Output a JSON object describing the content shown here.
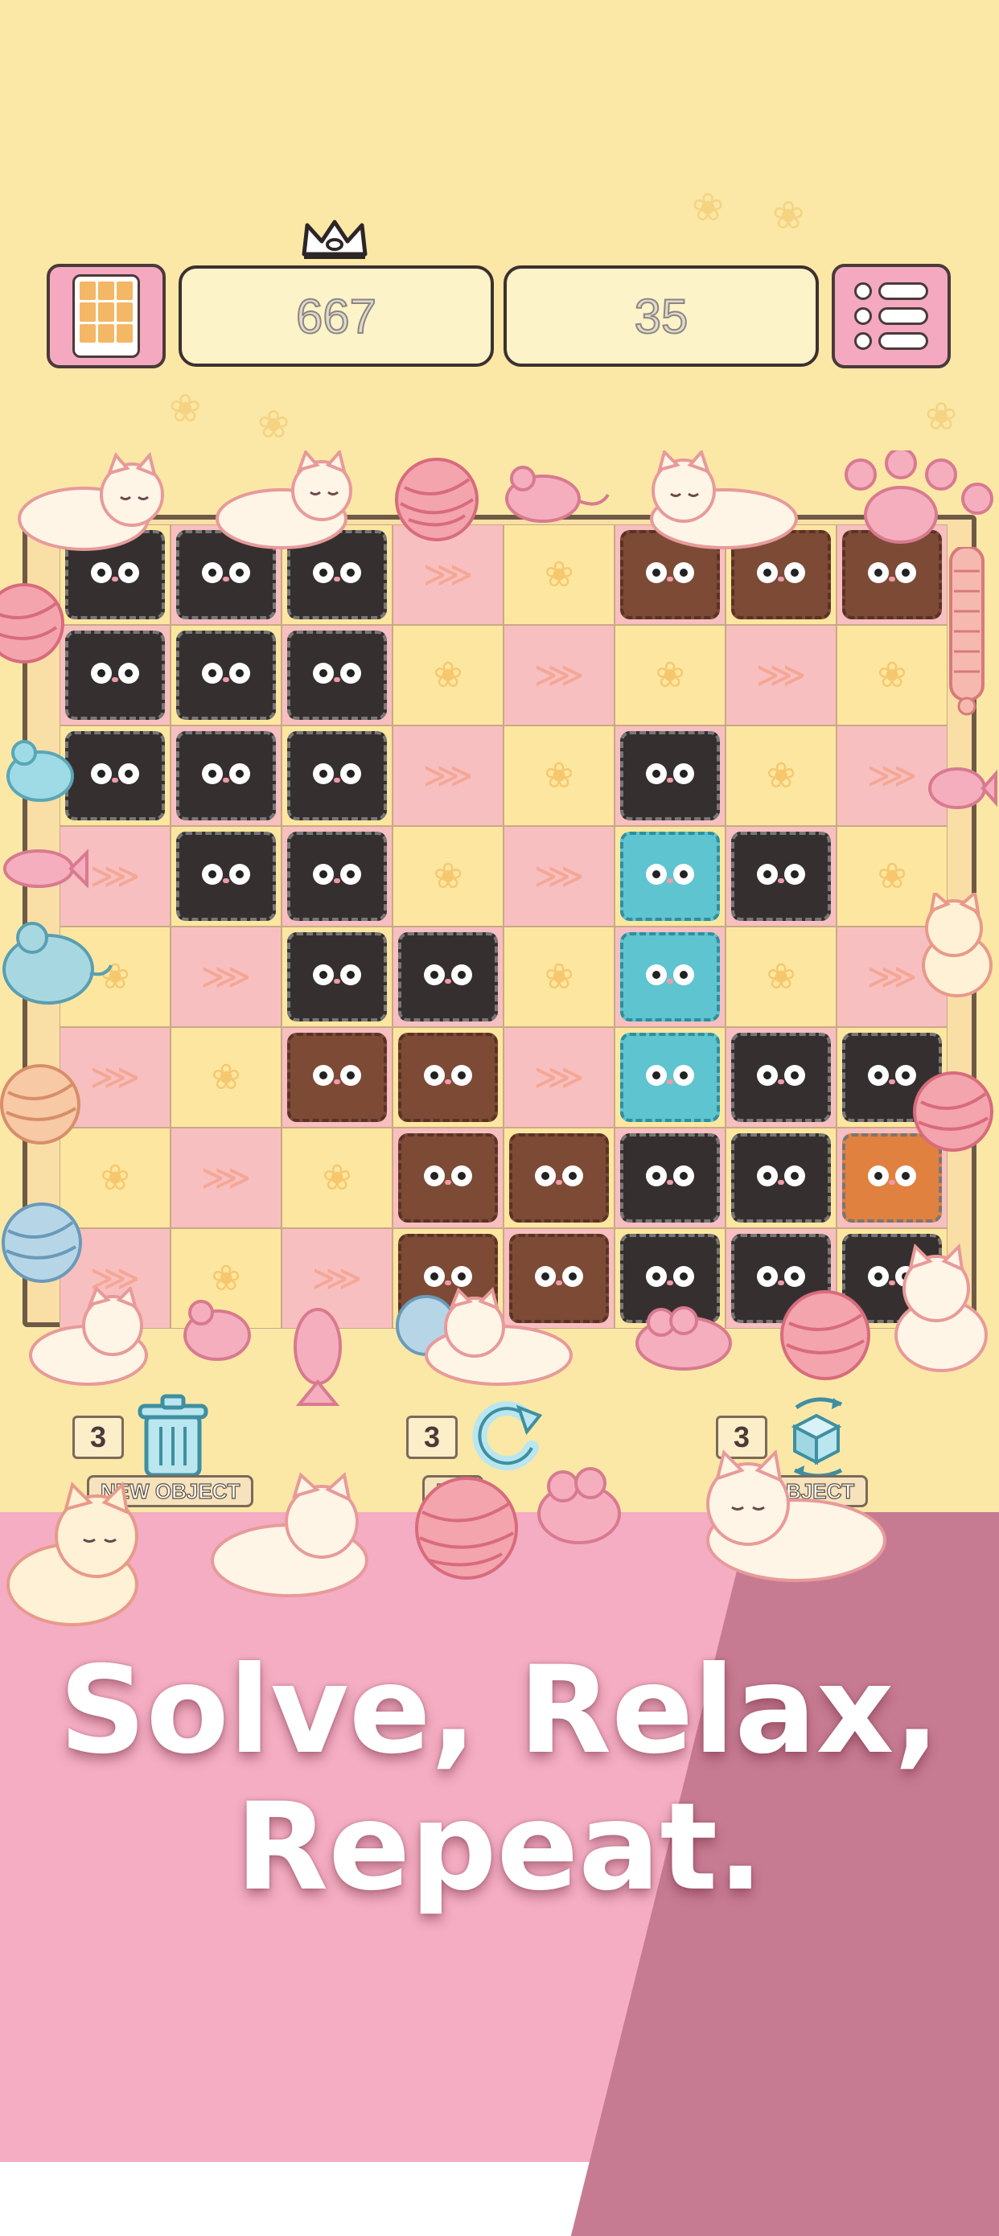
{
  "header": {
    "left_button_icon": "tablet-grid-icon",
    "best_score": "667",
    "current_score": "35",
    "crown_icon": "crown-icon",
    "right_button_icon": "menu-list-icon"
  },
  "board": {
    "rows": 8,
    "cols": 8,
    "tile_pattern": [
      [
        "yellow",
        "pink",
        "yellow",
        "pink",
        "yellow",
        "pink",
        "yellow",
        "pink"
      ],
      [
        "pink",
        "yellow",
        "pink",
        "yellow",
        "pink",
        "yellow",
        "pink",
        "yellow"
      ],
      [
        "yellow",
        "pink",
        "yellow",
        "pink",
        "yellow",
        "pink",
        "yellow",
        "pink"
      ],
      [
        "pink",
        "yellow",
        "pink",
        "yellow",
        "pink",
        "yellow",
        "pink",
        "yellow"
      ],
      [
        "yellow",
        "pink",
        "yellow",
        "pink",
        "yellow",
        "pink",
        "yellow",
        "pink"
      ],
      [
        "pink",
        "yellow",
        "pink",
        "yellow",
        "pink",
        "yellow",
        "pink",
        "yellow"
      ],
      [
        "yellow",
        "pink",
        "yellow",
        "pink",
        "yellow",
        "pink",
        "yellow",
        "pink"
      ],
      [
        "pink",
        "yellow",
        "pink",
        "yellow",
        "pink",
        "yellow",
        "pink",
        "yellow"
      ]
    ],
    "pieces": [
      [
        "black",
        "black",
        "black",
        "",
        "",
        "brown",
        "brown",
        "brown"
      ],
      [
        "black",
        "black",
        "black",
        "",
        "",
        "",
        "",
        ""
      ],
      [
        "black",
        "black",
        "black",
        "",
        "",
        "black",
        "",
        ""
      ],
      [
        "",
        "black",
        "black",
        "",
        "",
        "teal",
        "black",
        ""
      ],
      [
        "",
        "",
        "black",
        "black",
        "",
        "teal",
        "",
        ""
      ],
      [
        "",
        "",
        "brown",
        "brown",
        "",
        "teal",
        "black",
        "black"
      ],
      [
        "",
        "",
        "",
        "brown",
        "brown",
        "black",
        "black",
        "special"
      ],
      [
        "",
        "",
        "",
        "brown",
        "brown",
        "black",
        "black",
        "black"
      ]
    ],
    "colors": {
      "black": "#35302f",
      "brown": "#7d4a36",
      "teal": "#5ec4cf",
      "special": "#e0813f",
      "pink_tile": "#f8bfc0",
      "yellow_tile": "#fde7a0"
    }
  },
  "tools": [
    {
      "count": "3",
      "label": "NEW OBJECT",
      "icon": "trash-can-icon"
    },
    {
      "count": "3",
      "label": "MO",
      "icon": "rotate-arrow-icon"
    },
    {
      "count": "3",
      "label": "BJECT",
      "icon": "swap-cube-icon"
    }
  ],
  "headline": {
    "line1": "Solve, Relax,",
    "line2": "Repeat."
  }
}
